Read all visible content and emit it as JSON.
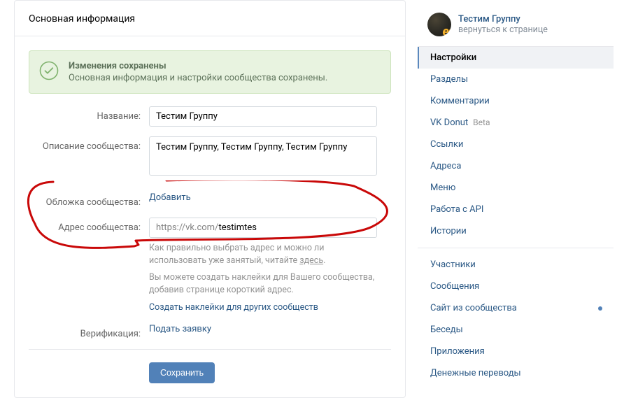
{
  "page": {
    "title": "Основная информация"
  },
  "notice": {
    "title": "Изменения сохранены",
    "text": "Основная информация и настройки сообщества сохранены."
  },
  "form": {
    "name_label": "Название:",
    "name_value": "Тестим Группу",
    "desc_label": "Описание сообщества:",
    "desc_value": "Тестим Группу, Тестим Группу, Тестим Группу",
    "cover_label": "Обложка сообщества:",
    "cover_action": "Добавить",
    "addr_label": "Адрес сообщества:",
    "addr_prefix": "https://vk.com/",
    "addr_value": "testimtes",
    "hint1_pre": "Как правильно выбрать адрес и можно ли использовать уже занятый, читайте ",
    "hint1_link": "здесь",
    "hint1_post": ".",
    "hint2": "Вы можете создать наклейки для Вашего сообщества, добавив странице короткий адрес.",
    "hint2_link": "Создать наклейки для других сообществ",
    "verify_label": "Верификация:",
    "verify_action": "Подать заявку",
    "save": "Сохранить"
  },
  "sidebar": {
    "group_name": "Тестим Группу",
    "back": "вернуться к странице",
    "nav1": [
      {
        "label": "Настройки",
        "active": true
      },
      {
        "label": "Разделы"
      },
      {
        "label": "Комментарии"
      },
      {
        "label": "VK Donut",
        "badge": "Beta"
      },
      {
        "label": "Ссылки"
      },
      {
        "label": "Адреса"
      },
      {
        "label": "Меню"
      },
      {
        "label": "Работа с API"
      },
      {
        "label": "Истории"
      }
    ],
    "nav2": [
      {
        "label": "Участники"
      },
      {
        "label": "Сообщения"
      },
      {
        "label": "Сайт из сообщества",
        "dot": true
      },
      {
        "label": "Беседы"
      },
      {
        "label": "Приложения"
      },
      {
        "label": "Денежные переводы"
      }
    ]
  }
}
